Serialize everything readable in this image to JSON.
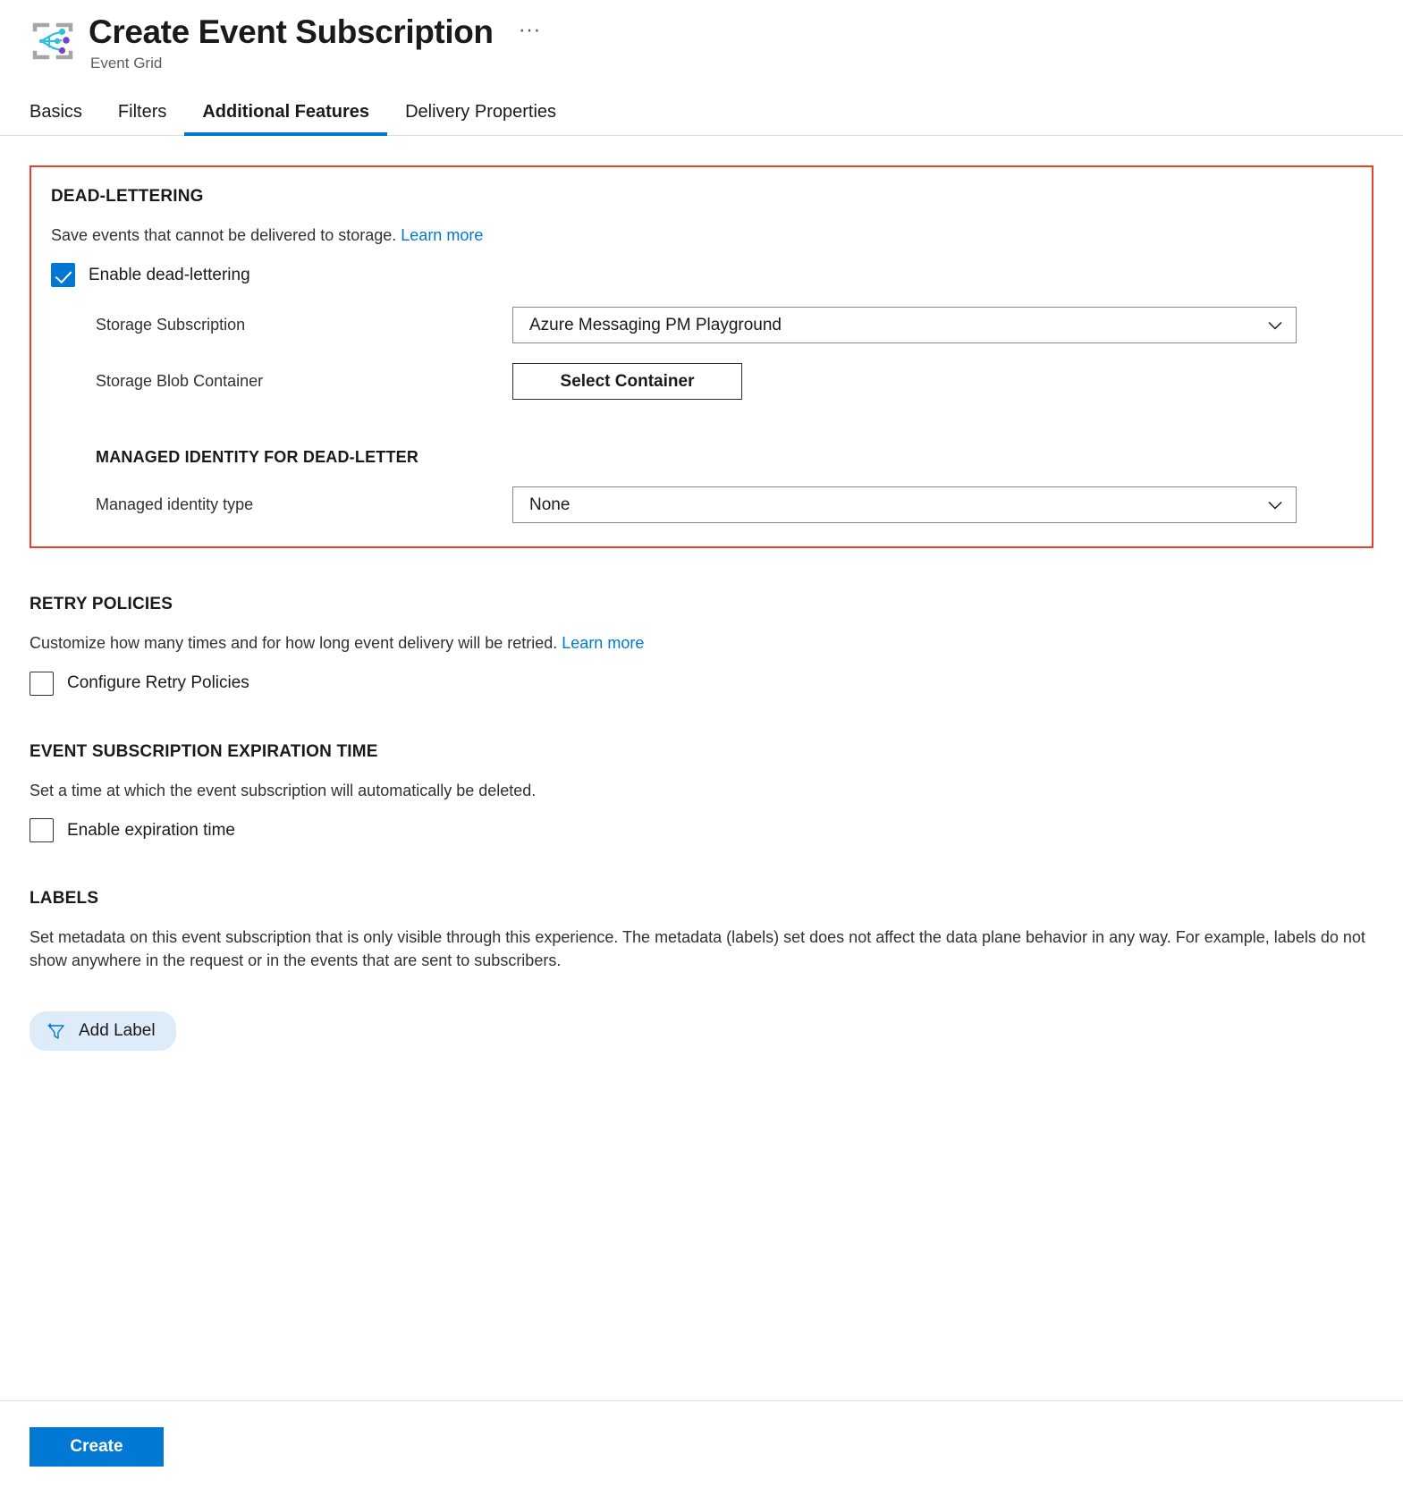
{
  "header": {
    "title": "Create Event Subscription",
    "subtitle": "Event Grid",
    "more_label": "···",
    "icon": "event-grid-icon"
  },
  "tabs": [
    {
      "label": "Basics",
      "active": false
    },
    {
      "label": "Filters",
      "active": false
    },
    {
      "label": "Additional Features",
      "active": true
    },
    {
      "label": "Delivery Properties",
      "active": false
    }
  ],
  "dead_lettering": {
    "heading": "DEAD-LETTERING",
    "description": "Save events that cannot be delivered to storage.",
    "learn_more": "Learn more",
    "enable_checkbox": {
      "label": "Enable dead-lettering",
      "checked": true
    },
    "storage_subscription": {
      "label": "Storage Subscription",
      "value": "Azure Messaging PM Playground"
    },
    "storage_blob_container": {
      "label": "Storage Blob Container",
      "button_label": "Select Container"
    },
    "managed_identity": {
      "heading": "MANAGED IDENTITY FOR DEAD-LETTER",
      "label": "Managed identity type",
      "value": "None"
    }
  },
  "retry_policies": {
    "heading": "RETRY POLICIES",
    "description": "Customize how many times and for how long event delivery will be retried.",
    "learn_more": "Learn more",
    "checkbox": {
      "label": "Configure Retry Policies",
      "checked": false
    }
  },
  "expiration": {
    "heading": "EVENT SUBSCRIPTION EXPIRATION TIME",
    "description": "Set a time at which the event subscription will automatically be deleted.",
    "checkbox": {
      "label": "Enable expiration time",
      "checked": false
    }
  },
  "labels": {
    "heading": "LABELS",
    "description": "Set metadata on this event subscription that is only visible through this experience. The metadata (labels) set does not affect the data plane behavior in any way. For example, labels do not show anywhere in the request or in the events that are sent to subscribers.",
    "add_label_button": "Add Label"
  },
  "footer": {
    "create_label": "Create"
  },
  "colors": {
    "accent": "#0078d4",
    "highlight_border": "#e8402a",
    "link": "#0078d4",
    "pill_background": "#deecf9"
  }
}
